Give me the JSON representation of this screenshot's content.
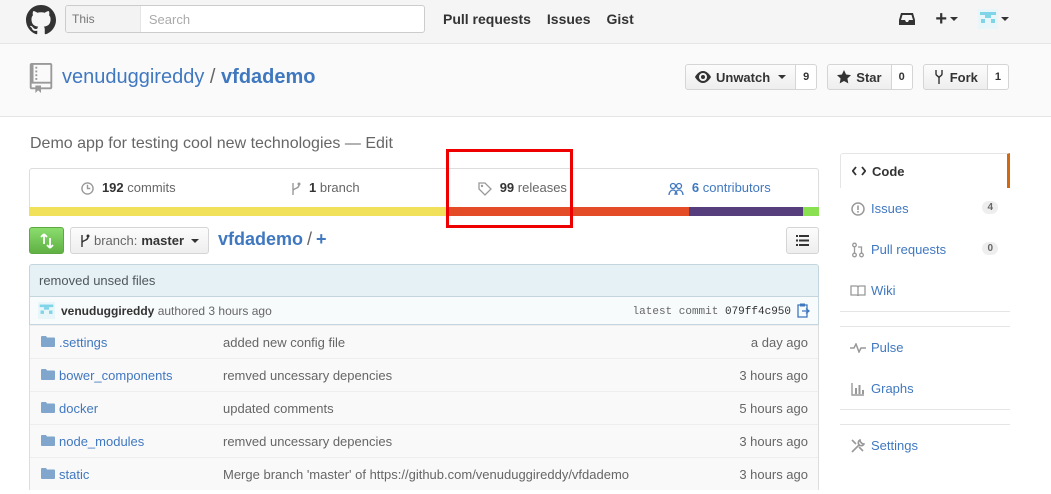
{
  "header": {
    "search_scope": "This repository",
    "search_placeholder": "Search",
    "nav": [
      "Pull requests",
      "Issues",
      "Gist"
    ],
    "plus": "+"
  },
  "repo": {
    "owner": "venuduggireddy",
    "separator": "/",
    "name": "vfdademo",
    "actions": {
      "unwatch_label": "Unwatch",
      "unwatch_count": "9",
      "star_label": "Star",
      "star_count": "0",
      "fork_label": "Fork",
      "fork_count": "1"
    }
  },
  "description": {
    "text": "Demo app for testing cool new technologies",
    "dash": "—",
    "edit": "Edit"
  },
  "numbers": {
    "commits_count": "192",
    "commits_label": "commits",
    "branch_count": "1",
    "branch_label": "branch",
    "releases_count": "99",
    "releases_label": "releases",
    "contributors_count": "6",
    "contributors_label": "contributors"
  },
  "language_bar": [
    {
      "color": "#f1e05a",
      "share": 53
    },
    {
      "color": "#e34c26",
      "share": 30.5
    },
    {
      "color": "#563d7c",
      "share": 14.5
    },
    {
      "color": "#89e051",
      "share": 2
    }
  ],
  "file_nav": {
    "branch_prefix": "branch:",
    "branch_name": "master",
    "breadcrumb_repo": "vfdademo",
    "breadcrumb_sep": "/",
    "breadcrumb_plus": "+"
  },
  "commit": {
    "message": "removed unsed files",
    "author": "venuduggireddy",
    "authored_text": "authored 3 hours ago",
    "latest_label": "latest commit",
    "sha": "079ff4c950"
  },
  "files": [
    {
      "name": ".settings",
      "message": "added new config file",
      "age": "a day ago"
    },
    {
      "name": "bower_components",
      "message": "remved uncessary depencies",
      "age": "3 hours ago"
    },
    {
      "name": "docker",
      "message": "updated comments",
      "age": "5 hours ago"
    },
    {
      "name": "node_modules",
      "message": "remved uncessary depencies",
      "age": "3 hours ago"
    },
    {
      "name": "static",
      "message": "Merge branch 'master' of https://github.com/venuduggireddy/vfdademo",
      "age": "3 hours ago"
    }
  ],
  "sidebar": {
    "code": "Code",
    "issues": "Issues",
    "issues_count": "4",
    "pulls": "Pull requests",
    "pulls_count": "0",
    "wiki": "Wiki",
    "pulse": "Pulse",
    "graphs": "Graphs",
    "settings": "Settings"
  },
  "colors": {
    "link": "#4078c0",
    "highlight": "#e00000",
    "selected_accent": "#d26911"
  }
}
